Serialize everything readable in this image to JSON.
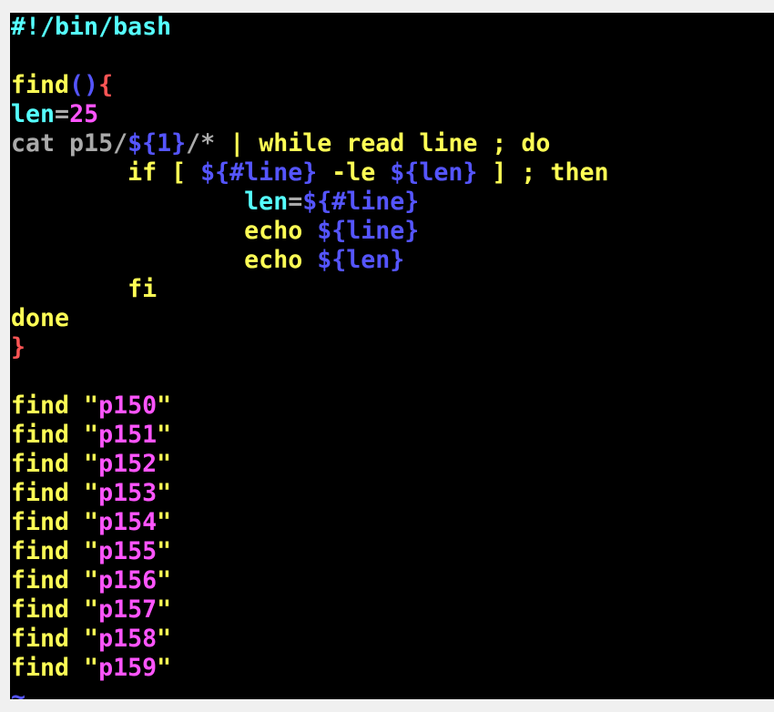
{
  "colors": {
    "cyan": "#55ffff",
    "yellow": "#ffff55",
    "blue": "#5555ff",
    "red": "#ff5555",
    "magenta": "#ff55ff",
    "gray": "#aaaaaa"
  },
  "editor": {
    "lines": [
      [
        [
          "cyan",
          "#!/bin/bash"
        ]
      ],
      [],
      [
        [
          "yellow",
          "find"
        ],
        [
          "blue",
          "()"
        ],
        [
          "red",
          "{"
        ]
      ],
      [
        [
          "cyan",
          "len"
        ],
        [
          "gray",
          "="
        ],
        [
          "magenta",
          "25"
        ]
      ],
      [
        [
          "gray",
          "cat p15/"
        ],
        [
          "blue",
          "${1}"
        ],
        [
          "gray",
          "/* "
        ],
        [
          "yellow",
          "| while read line ; do"
        ]
      ],
      [
        [
          "yellow",
          "        if [ "
        ],
        [
          "blue",
          "${#line}"
        ],
        [
          "yellow",
          " -le "
        ],
        [
          "blue",
          "${len}"
        ],
        [
          "yellow",
          " ] ; then"
        ]
      ],
      [
        [
          "cyan",
          "                len"
        ],
        [
          "gray",
          "="
        ],
        [
          "blue",
          "${#line}"
        ]
      ],
      [
        [
          "yellow",
          "                echo "
        ],
        [
          "blue",
          "${line}"
        ]
      ],
      [
        [
          "yellow",
          "                echo "
        ],
        [
          "blue",
          "${len}"
        ]
      ],
      [
        [
          "yellow",
          "        fi"
        ]
      ],
      [
        [
          "yellow",
          "done"
        ]
      ],
      [
        [
          "red",
          "}"
        ]
      ],
      [],
      [
        [
          "yellow",
          "find \""
        ],
        [
          "magenta",
          "p150"
        ],
        [
          "yellow",
          "\""
        ]
      ],
      [
        [
          "yellow",
          "find \""
        ],
        [
          "magenta",
          "p151"
        ],
        [
          "yellow",
          "\""
        ]
      ],
      [
        [
          "yellow",
          "find \""
        ],
        [
          "magenta",
          "p152"
        ],
        [
          "yellow",
          "\""
        ]
      ],
      [
        [
          "yellow",
          "find \""
        ],
        [
          "magenta",
          "p153"
        ],
        [
          "yellow",
          "\""
        ]
      ],
      [
        [
          "yellow",
          "find \""
        ],
        [
          "magenta",
          "p154"
        ],
        [
          "yellow",
          "\""
        ]
      ],
      [
        [
          "yellow",
          "find \""
        ],
        [
          "magenta",
          "p155"
        ],
        [
          "yellow",
          "\""
        ]
      ],
      [
        [
          "yellow",
          "find \""
        ],
        [
          "magenta",
          "p156"
        ],
        [
          "yellow",
          "\""
        ]
      ],
      [
        [
          "yellow",
          "find \""
        ],
        [
          "magenta",
          "p157"
        ],
        [
          "yellow",
          "\""
        ]
      ],
      [
        [
          "yellow",
          "find \""
        ],
        [
          "magenta",
          "p158"
        ],
        [
          "yellow",
          "\""
        ]
      ],
      [
        [
          "yellow",
          "find \""
        ],
        [
          "magenta",
          "p159"
        ],
        [
          "yellow",
          "\""
        ]
      ],
      [
        [
          "blue",
          "~"
        ]
      ]
    ]
  }
}
